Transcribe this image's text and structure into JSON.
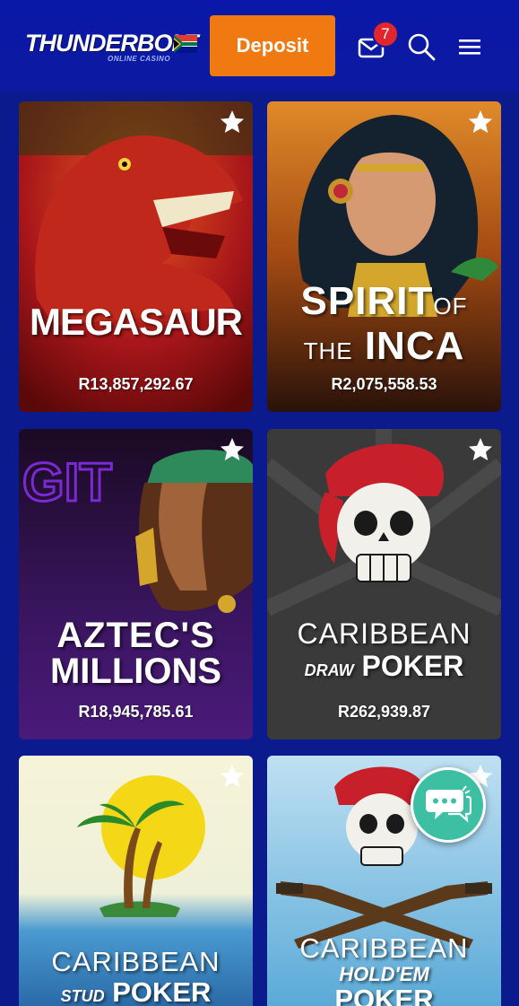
{
  "header": {
    "logo_text": "THUNDERBOLT",
    "logo_sub": "ONLINE CASINO",
    "deposit_label": "Deposit",
    "notification_count": "7",
    "icons": [
      "mail-icon",
      "search-icon",
      "menu-icon"
    ]
  },
  "games": [
    {
      "title": "MEGASAUR",
      "jackpot": "R13,857,292.67"
    },
    {
      "title_line1": "SPIRIT",
      "title_of": "OF",
      "title_the": "THE",
      "title_line2": "INCA",
      "jackpot": "R2,075,558.53"
    },
    {
      "title_line1": "AZTEC'S",
      "title_line2": "MILLIONS",
      "jackpot": "R18,945,785.61"
    },
    {
      "title_line1": "CARIBBEAN",
      "title_small": "DRAW",
      "title_line2": "POKER",
      "jackpot": "R262,939.87"
    },
    {
      "title_line1": "CARIBBEAN",
      "title_small": "STUD",
      "title_line2": "POKER"
    },
    {
      "title_line1": "CARIBBEAN",
      "title_small": "HOLD'EM",
      "title_line2": "POKER"
    }
  ],
  "colors": {
    "background": "#0b1a8c",
    "deposit": "#f07a11",
    "badge": "#e1262d",
    "chat": "#3dbfa4"
  }
}
